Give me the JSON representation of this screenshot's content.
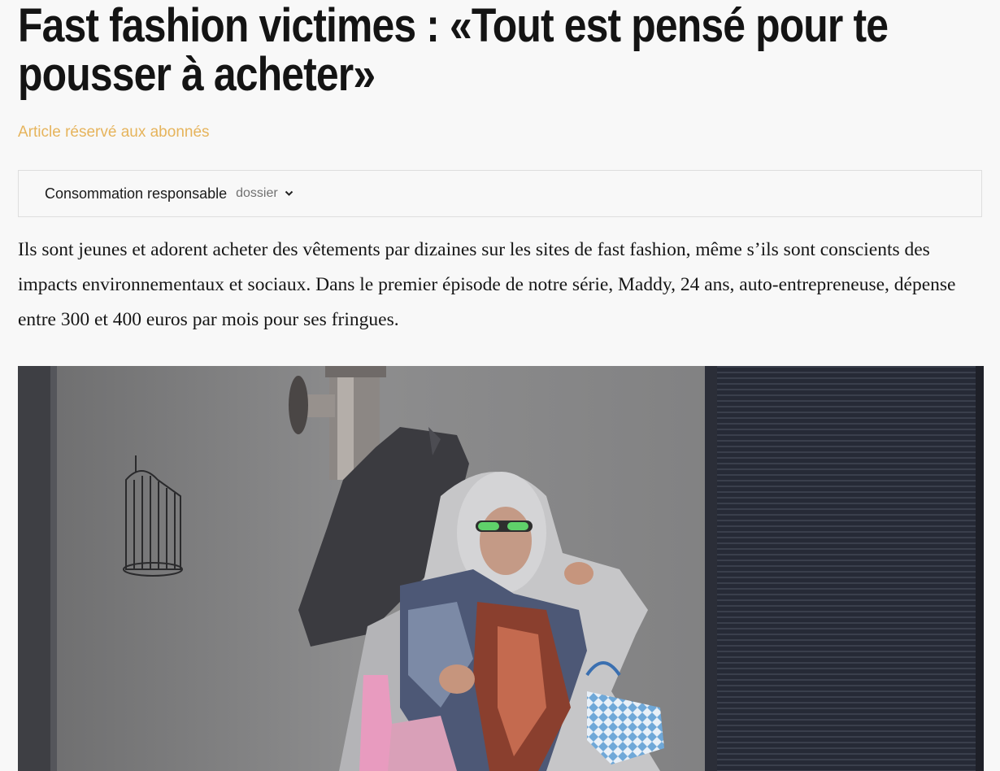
{
  "article": {
    "title": "Fast fashion victimes : «Tout est pensé pour te pousser à acheter»",
    "access_label": "Article réservé aux abonnés",
    "dossier": {
      "name": "Consommation responsable",
      "tag": "dossier",
      "icon": "chevron-down-icon"
    },
    "lead": "Ils sont jeunes et adorent acheter des vêtements par dizaines sur les sites de fast fashion, même s’ils sont conscients des impacts environnementaux et sociaux. Dans le premier épisode de notre série, Maddy, 24 ans, auto-entrepreneuse, dépense entre 300 et 400 euros par mois pour ses fringues."
  },
  "colors": {
    "background": "#f8f8f8",
    "accent_premium": "#e6b45c",
    "border": "#dedede"
  }
}
